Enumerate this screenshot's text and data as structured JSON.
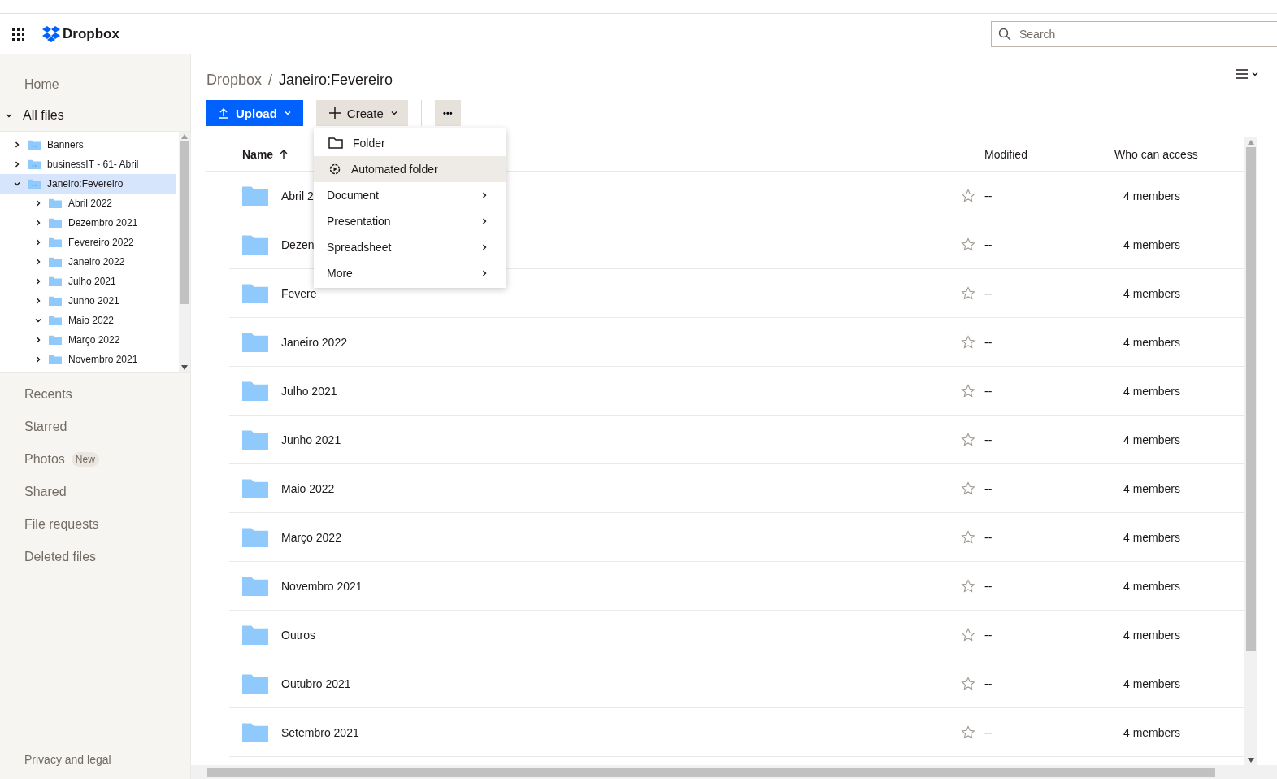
{
  "header": {
    "logo": "Dropbox",
    "search": {
      "placeholder": "Search"
    }
  },
  "sidebar": {
    "top_items": [
      {
        "label": "Home",
        "selected": false
      },
      {
        "label": "All files",
        "selected": true,
        "expanded": true
      }
    ],
    "tree": [
      {
        "label": "Banners",
        "expanded": false,
        "selected": false
      },
      {
        "label": "businessIT - 61- Abril",
        "expanded": false,
        "selected": false
      },
      {
        "label": "Janeiro:Fevereiro",
        "expanded": true,
        "selected": true,
        "children": [
          {
            "label": "Abril 2022",
            "expanded": false,
            "selected": false
          },
          {
            "label": "Dezembro 2021",
            "expanded": false,
            "selected": false
          },
          {
            "label": "Fevereiro 2022",
            "expanded": false,
            "selected": false
          },
          {
            "label": "Janeiro 2022",
            "expanded": false,
            "selected": false
          },
          {
            "label": "Julho 2021",
            "expanded": false,
            "selected": false
          },
          {
            "label": "Junho 2021",
            "expanded": false,
            "selected": false
          },
          {
            "label": "Maio 2022",
            "expanded": true,
            "selected": false
          },
          {
            "label": "Março 2022",
            "expanded": false,
            "selected": false
          },
          {
            "label": "Novembro 2021",
            "expanded": false,
            "selected": false
          }
        ]
      }
    ],
    "nav": [
      {
        "label": "Recents"
      },
      {
        "label": "Starred"
      },
      {
        "label": "Photos",
        "badge": "New"
      },
      {
        "label": "Shared"
      },
      {
        "label": "File requests"
      },
      {
        "label": "Deleted files"
      }
    ],
    "footer": "Privacy and legal"
  },
  "breadcrumb": {
    "separator": "/",
    "items": [
      "Dropbox",
      "Janeiro:Fevereiro"
    ]
  },
  "toolbar": {
    "upload": "Upload",
    "create": "Create",
    "more": "•••"
  },
  "create_menu": [
    {
      "label": "Folder",
      "kind": "icon",
      "selected": false
    },
    {
      "label": "Automated folder",
      "kind": "icon",
      "selected": true
    },
    {
      "label": "Document",
      "kind": "submenu",
      "selected": false
    },
    {
      "label": "Presentation",
      "kind": "submenu",
      "selected": false
    },
    {
      "label": "Spreadsheet",
      "kind": "submenu",
      "selected": false
    },
    {
      "label": "More",
      "kind": "submenu",
      "selected": false
    }
  ],
  "table": {
    "columns": [
      "Name",
      "Modified",
      "Who can access"
    ],
    "rows": [
      {
        "name": "Abril 2",
        "modified": "--",
        "access": "4 members",
        "starred": false
      },
      {
        "name": "Dezen",
        "modified": "--",
        "access": "4 members",
        "starred": false
      },
      {
        "name": "Fevere",
        "modified": "--",
        "access": "4 members",
        "starred": false
      },
      {
        "name": "Janeiro 2022",
        "modified": "--",
        "access": "4 members",
        "starred": false
      },
      {
        "name": "Julho 2021",
        "modified": "--",
        "access": "4 members",
        "starred": false
      },
      {
        "name": "Junho 2021",
        "modified": "--",
        "access": "4 members",
        "starred": false
      },
      {
        "name": "Maio 2022",
        "modified": "--",
        "access": "4 members",
        "starred": false
      },
      {
        "name": "Março 2022",
        "modified": "--",
        "access": "4 members",
        "starred": false
      },
      {
        "name": "Novembro 2021",
        "modified": "--",
        "access": "4 members",
        "starred": false
      },
      {
        "name": "Outros",
        "modified": "--",
        "access": "4 members",
        "starred": false
      },
      {
        "name": "Outubro 2021",
        "modified": "--",
        "access": "4 members",
        "starred": false
      },
      {
        "name": "Setembro 2021",
        "modified": "--",
        "access": "4 members",
        "starred": false
      }
    ]
  }
}
